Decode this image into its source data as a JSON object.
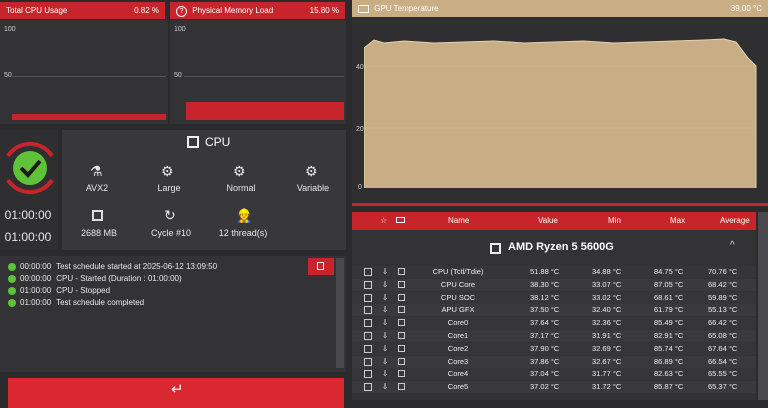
{
  "cpu_usage": {
    "title": "Total CPU Usage",
    "value": "0.82 %",
    "ticks": [
      "100",
      "50",
      "0"
    ],
    "level": 0.02
  },
  "memory_load": {
    "title": "Physical Memory Load",
    "value": "15.80 %",
    "ticks": [
      "100",
      "50",
      "0"
    ],
    "level": 0.16
  },
  "gpu_temp": {
    "title": "GPU Temperature",
    "value": "39.00 °C",
    "ticks": [
      "40",
      "20",
      "0"
    ]
  },
  "status": {
    "times": [
      "01:00:00",
      "01:00:00"
    ]
  },
  "cpu_test": {
    "title": "CPU",
    "options": [
      {
        "label": "AVX2",
        "icon": "flask-icon"
      },
      {
        "label": "Large",
        "icon": "gears-icon"
      },
      {
        "label": "Normal",
        "icon": "gears-icon"
      },
      {
        "label": "Variable",
        "icon": "gears-icon"
      },
      {
        "label": "2688 MB",
        "icon": "chip-icon"
      },
      {
        "label": "Cycle #10",
        "icon": "refresh-icon"
      },
      {
        "label": "12 thread(s)",
        "icon": "worker-icon"
      }
    ]
  },
  "log": [
    {
      "time": "00:00:00",
      "text": "Test schedule started at 2025-06-12 13:09:50"
    },
    {
      "time": "00:00:00",
      "text": "CPU - Started (Duration : 01:00:00)"
    },
    {
      "time": "01:00:00",
      "text": "CPU - Stopped"
    },
    {
      "time": "01:00:00",
      "text": "Test schedule completed"
    }
  ],
  "sensor_table": {
    "columns": [
      "Name",
      "Value",
      "Min",
      "Max",
      "Average"
    ],
    "device": "AMD Ryzen 5 5600G",
    "rows": [
      {
        "name": "CPU (Tctl/Tdie)",
        "value": "51.88 °C",
        "min": "34.88 °C",
        "max": "84.75 °C",
        "avg": "70.76 °C"
      },
      {
        "name": "CPU Core",
        "value": "38.30 °C",
        "min": "33.07 °C",
        "max": "87.05 °C",
        "avg": "68.42 °C"
      },
      {
        "name": "CPU SOC",
        "value": "38.12 °C",
        "min": "33.02 °C",
        "max": "68.61 °C",
        "avg": "59.89 °C"
      },
      {
        "name": "APU GFX",
        "value": "37.50 °C",
        "min": "32.40 °C",
        "max": "61.79 °C",
        "avg": "55.13 °C"
      },
      {
        "name": "Core0",
        "value": "37.64 °C",
        "min": "32.36 °C",
        "max": "85.49 °C",
        "avg": "66.42 °C"
      },
      {
        "name": "Core1",
        "value": "37.17 °C",
        "min": "31.91 °C",
        "max": "82.91 °C",
        "avg": "65.08 °C"
      },
      {
        "name": "Core2",
        "value": "37.90 °C",
        "min": "32.69 °C",
        "max": "85.74 °C",
        "avg": "67.64 °C"
      },
      {
        "name": "Core3",
        "value": "37.86 °C",
        "min": "32.67 °C",
        "max": "86.89 °C",
        "avg": "66.54 °C"
      },
      {
        "name": "Core4",
        "value": "37.04 °C",
        "min": "31.77 °C",
        "max": "82.63 °C",
        "avg": "65.55 °C"
      },
      {
        "name": "Core5",
        "value": "37.02 °C",
        "min": "31.72 °C",
        "max": "85.87 °C",
        "avg": "65.37 °C"
      }
    ]
  },
  "colors": {
    "accent": "#c8242b",
    "graph_fill": "#c9ad85",
    "ok": "#5fc33a"
  }
}
